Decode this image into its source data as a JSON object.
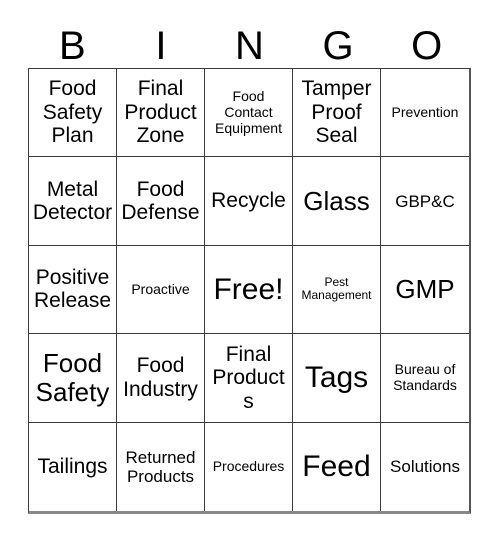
{
  "header": {
    "letters": [
      "B",
      "I",
      "N",
      "G",
      "O"
    ]
  },
  "grid": {
    "rows": 5,
    "columns": 5,
    "cells": [
      {
        "text": "Food Safety Plan",
        "size": "fs-md"
      },
      {
        "text": "Final Product Zone",
        "size": "fs-md"
      },
      {
        "text": "Food Contact Equipment",
        "size": "fs-xs"
      },
      {
        "text": "Tamper Proof Seal",
        "size": "fs-md"
      },
      {
        "text": "Prevention",
        "size": "fs-xs"
      },
      {
        "text": "Metal Detector",
        "size": "fs-md"
      },
      {
        "text": "Food Defense",
        "size": "fs-md"
      },
      {
        "text": "Recycle",
        "size": "fs-md"
      },
      {
        "text": "Glass",
        "size": "fs-lg"
      },
      {
        "text": "GBP&C",
        "size": "fs-sm"
      },
      {
        "text": "Positive Release",
        "size": "fs-md"
      },
      {
        "text": "Proactive",
        "size": "fs-xs"
      },
      {
        "text": "Free!",
        "size": "fs-xl"
      },
      {
        "text": "Pest Management",
        "size": "fs-xxs"
      },
      {
        "text": "GMP",
        "size": "fs-lg"
      },
      {
        "text": "Food Safety",
        "size": "fs-lg"
      },
      {
        "text": "Food Industry",
        "size": "fs-md"
      },
      {
        "text": "Final Products",
        "size": "fs-md"
      },
      {
        "text": "Tags",
        "size": "fs-xl"
      },
      {
        "text": "Bureau of Standards",
        "size": "fs-xs"
      },
      {
        "text": "Tailings",
        "size": "fs-md"
      },
      {
        "text": "Returned Products",
        "size": "fs-sm"
      },
      {
        "text": "Procedures",
        "size": "fs-xs"
      },
      {
        "text": "Feed",
        "size": "fs-xl"
      },
      {
        "text": "Solutions",
        "size": "fs-sm"
      }
    ]
  }
}
